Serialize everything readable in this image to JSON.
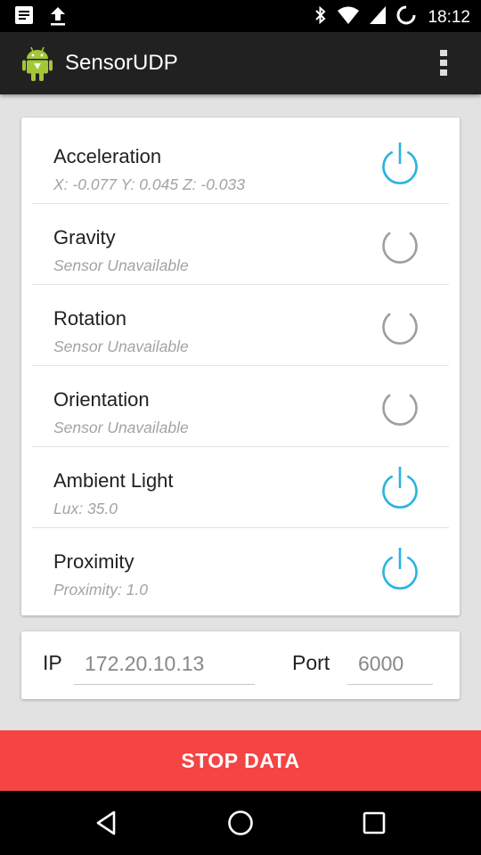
{
  "status_bar": {
    "time": "18:12",
    "left_icons": [
      "notification-icon",
      "upload-icon"
    ],
    "right_icons": [
      "bluetooth-icon",
      "wifi-icon",
      "signal-icon",
      "sync-icon"
    ]
  },
  "app_bar": {
    "title": "SensorUDP",
    "icon": "android-robot-icon",
    "menu_icon": "overflow-menu-icon"
  },
  "sensors": [
    {
      "name": "Acceleration",
      "value": "X: -0.077 Y: 0.045 Z: -0.033",
      "enabled": true
    },
    {
      "name": "Gravity",
      "value": "Sensor Unavailable",
      "enabled": false
    },
    {
      "name": "Rotation",
      "value": "Sensor Unavailable",
      "enabled": false
    },
    {
      "name": "Orientation",
      "value": "Sensor Unavailable",
      "enabled": false
    },
    {
      "name": "Ambient Light",
      "value": "Lux: 35.0",
      "enabled": true
    },
    {
      "name": "Proximity",
      "value": "Proximity: 1.0",
      "enabled": true
    }
  ],
  "connection": {
    "ip_label": "IP",
    "ip_placeholder": "172.20.10.13",
    "port_label": "Port",
    "port_placeholder": "6000"
  },
  "stop_button": {
    "label": "STOP DATA"
  },
  "colors": {
    "accent": "#2bb3e0",
    "disabled": "#9e9e9e",
    "stop": "#f44444",
    "app_bar": "#212121"
  },
  "nav_bar": {
    "icons": [
      "back-icon",
      "home-icon",
      "recents-icon"
    ]
  }
}
